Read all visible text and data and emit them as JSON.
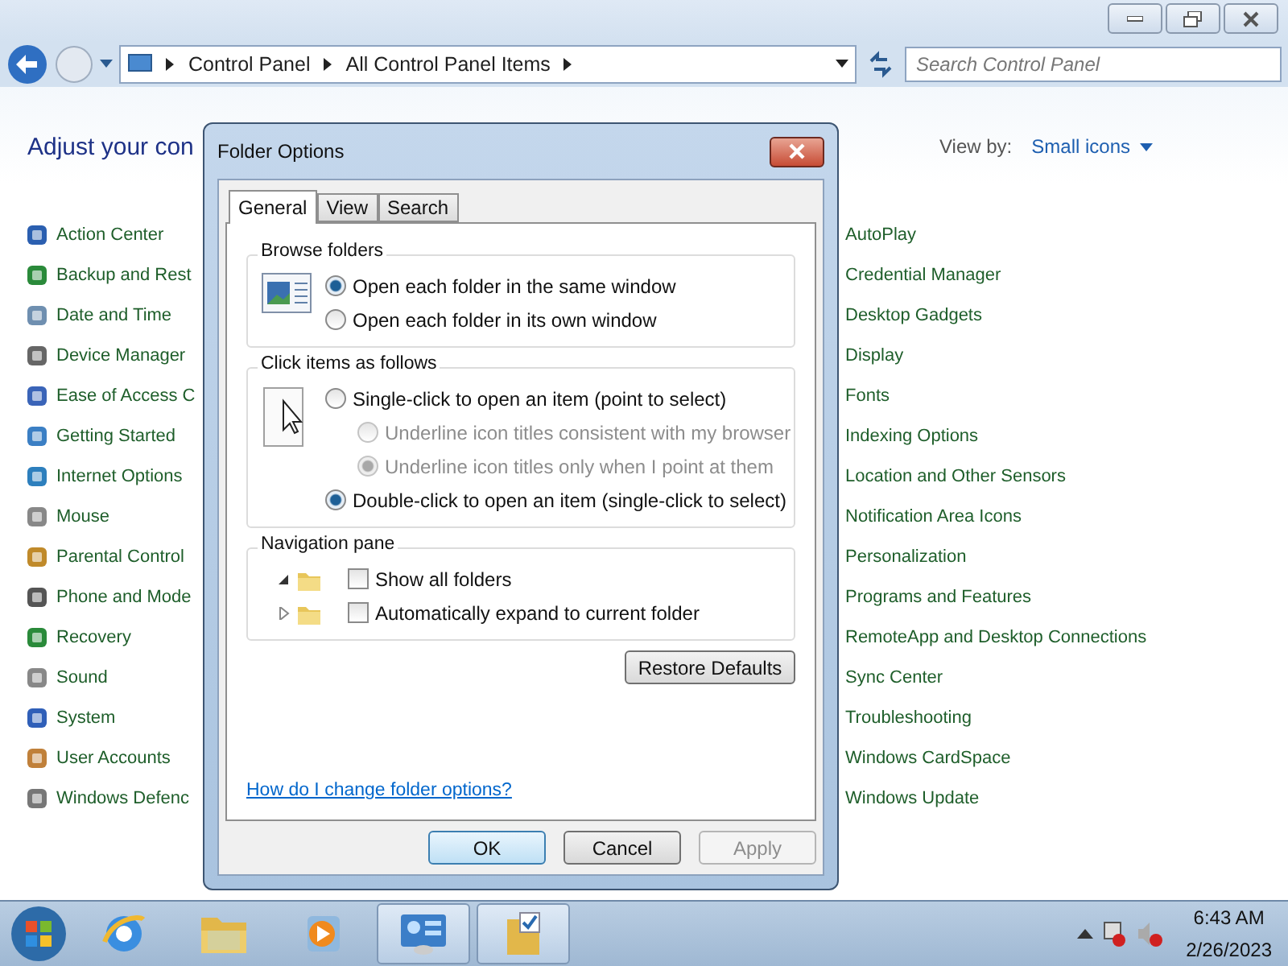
{
  "window": {
    "breadcrumb": [
      "Control Panel",
      "All Control Panel Items"
    ],
    "search": {
      "placeholder": "Search Control Panel"
    },
    "heading": "Adjust your con",
    "view_by": {
      "label": "View by:",
      "value": "Small icons"
    }
  },
  "items_left": [
    "Action Center",
    "Backup and Rest",
    "Date and Time",
    "Device Manager",
    "Ease of Access C",
    "Getting Started",
    "Internet Options",
    "Mouse",
    "Parental Control",
    "Phone and Mode",
    "Recovery",
    "Sound",
    "System",
    "User Accounts",
    "Windows Defenc"
  ],
  "items_right": [
    "AutoPlay",
    "Credential Manager",
    "Desktop Gadgets",
    "Display",
    "Fonts",
    "Indexing Options",
    "Location and Other Sensors",
    "Notification Area Icons",
    "Personalization",
    "Programs and Features",
    "RemoteApp and Desktop Connections",
    "Sync Center",
    "Troubleshooting",
    "Windows CardSpace",
    "Windows Update"
  ],
  "dialog": {
    "title": "Folder Options",
    "tabs": [
      {
        "label": "General",
        "selected": true
      },
      {
        "label": "View",
        "selected": false
      },
      {
        "label": "Search",
        "selected": false
      }
    ],
    "browse_folders": {
      "title": "Browse folders",
      "options": [
        {
          "label": "Open each folder in the same window",
          "selected": true,
          "disabled": false
        },
        {
          "label": "Open each folder in its own window",
          "selected": false,
          "disabled": false
        }
      ]
    },
    "click_items": {
      "title": "Click items as follows",
      "options": [
        {
          "label": "Single-click to open an item (point to select)",
          "selected": false,
          "disabled": false,
          "sub": false
        },
        {
          "label": "Underline icon titles consistent with my browser",
          "selected": false,
          "disabled": true,
          "sub": true
        },
        {
          "label": "Underline icon titles only when I point at them",
          "selected": true,
          "disabled": true,
          "sub": true
        },
        {
          "label": "Double-click to open an item (single-click to select)",
          "selected": true,
          "disabled": false,
          "sub": false
        }
      ]
    },
    "navigation_pane": {
      "title": "Navigation pane",
      "options": [
        {
          "label": "Show all folders",
          "checked": false,
          "expanded": true
        },
        {
          "label": "Automatically expand to current folder",
          "checked": false,
          "expanded": false
        }
      ]
    },
    "restore": "Restore Defaults",
    "help_link": "How do I change folder options?",
    "buttons": [
      {
        "label": "OK",
        "default": true,
        "disabled": false
      },
      {
        "label": "Cancel",
        "default": false,
        "disabled": false
      },
      {
        "label": "Apply",
        "default": false,
        "disabled": true
      }
    ]
  },
  "taskbar": {
    "apps": [
      {
        "kind": "browser",
        "active": false
      },
      {
        "kind": "explorer",
        "active": false
      },
      {
        "kind": "media",
        "active": false
      },
      {
        "kind": "control",
        "active": true
      },
      {
        "kind": "folder",
        "active": true
      }
    ],
    "time": "6:43 AM",
    "date": "2/26/2023"
  }
}
